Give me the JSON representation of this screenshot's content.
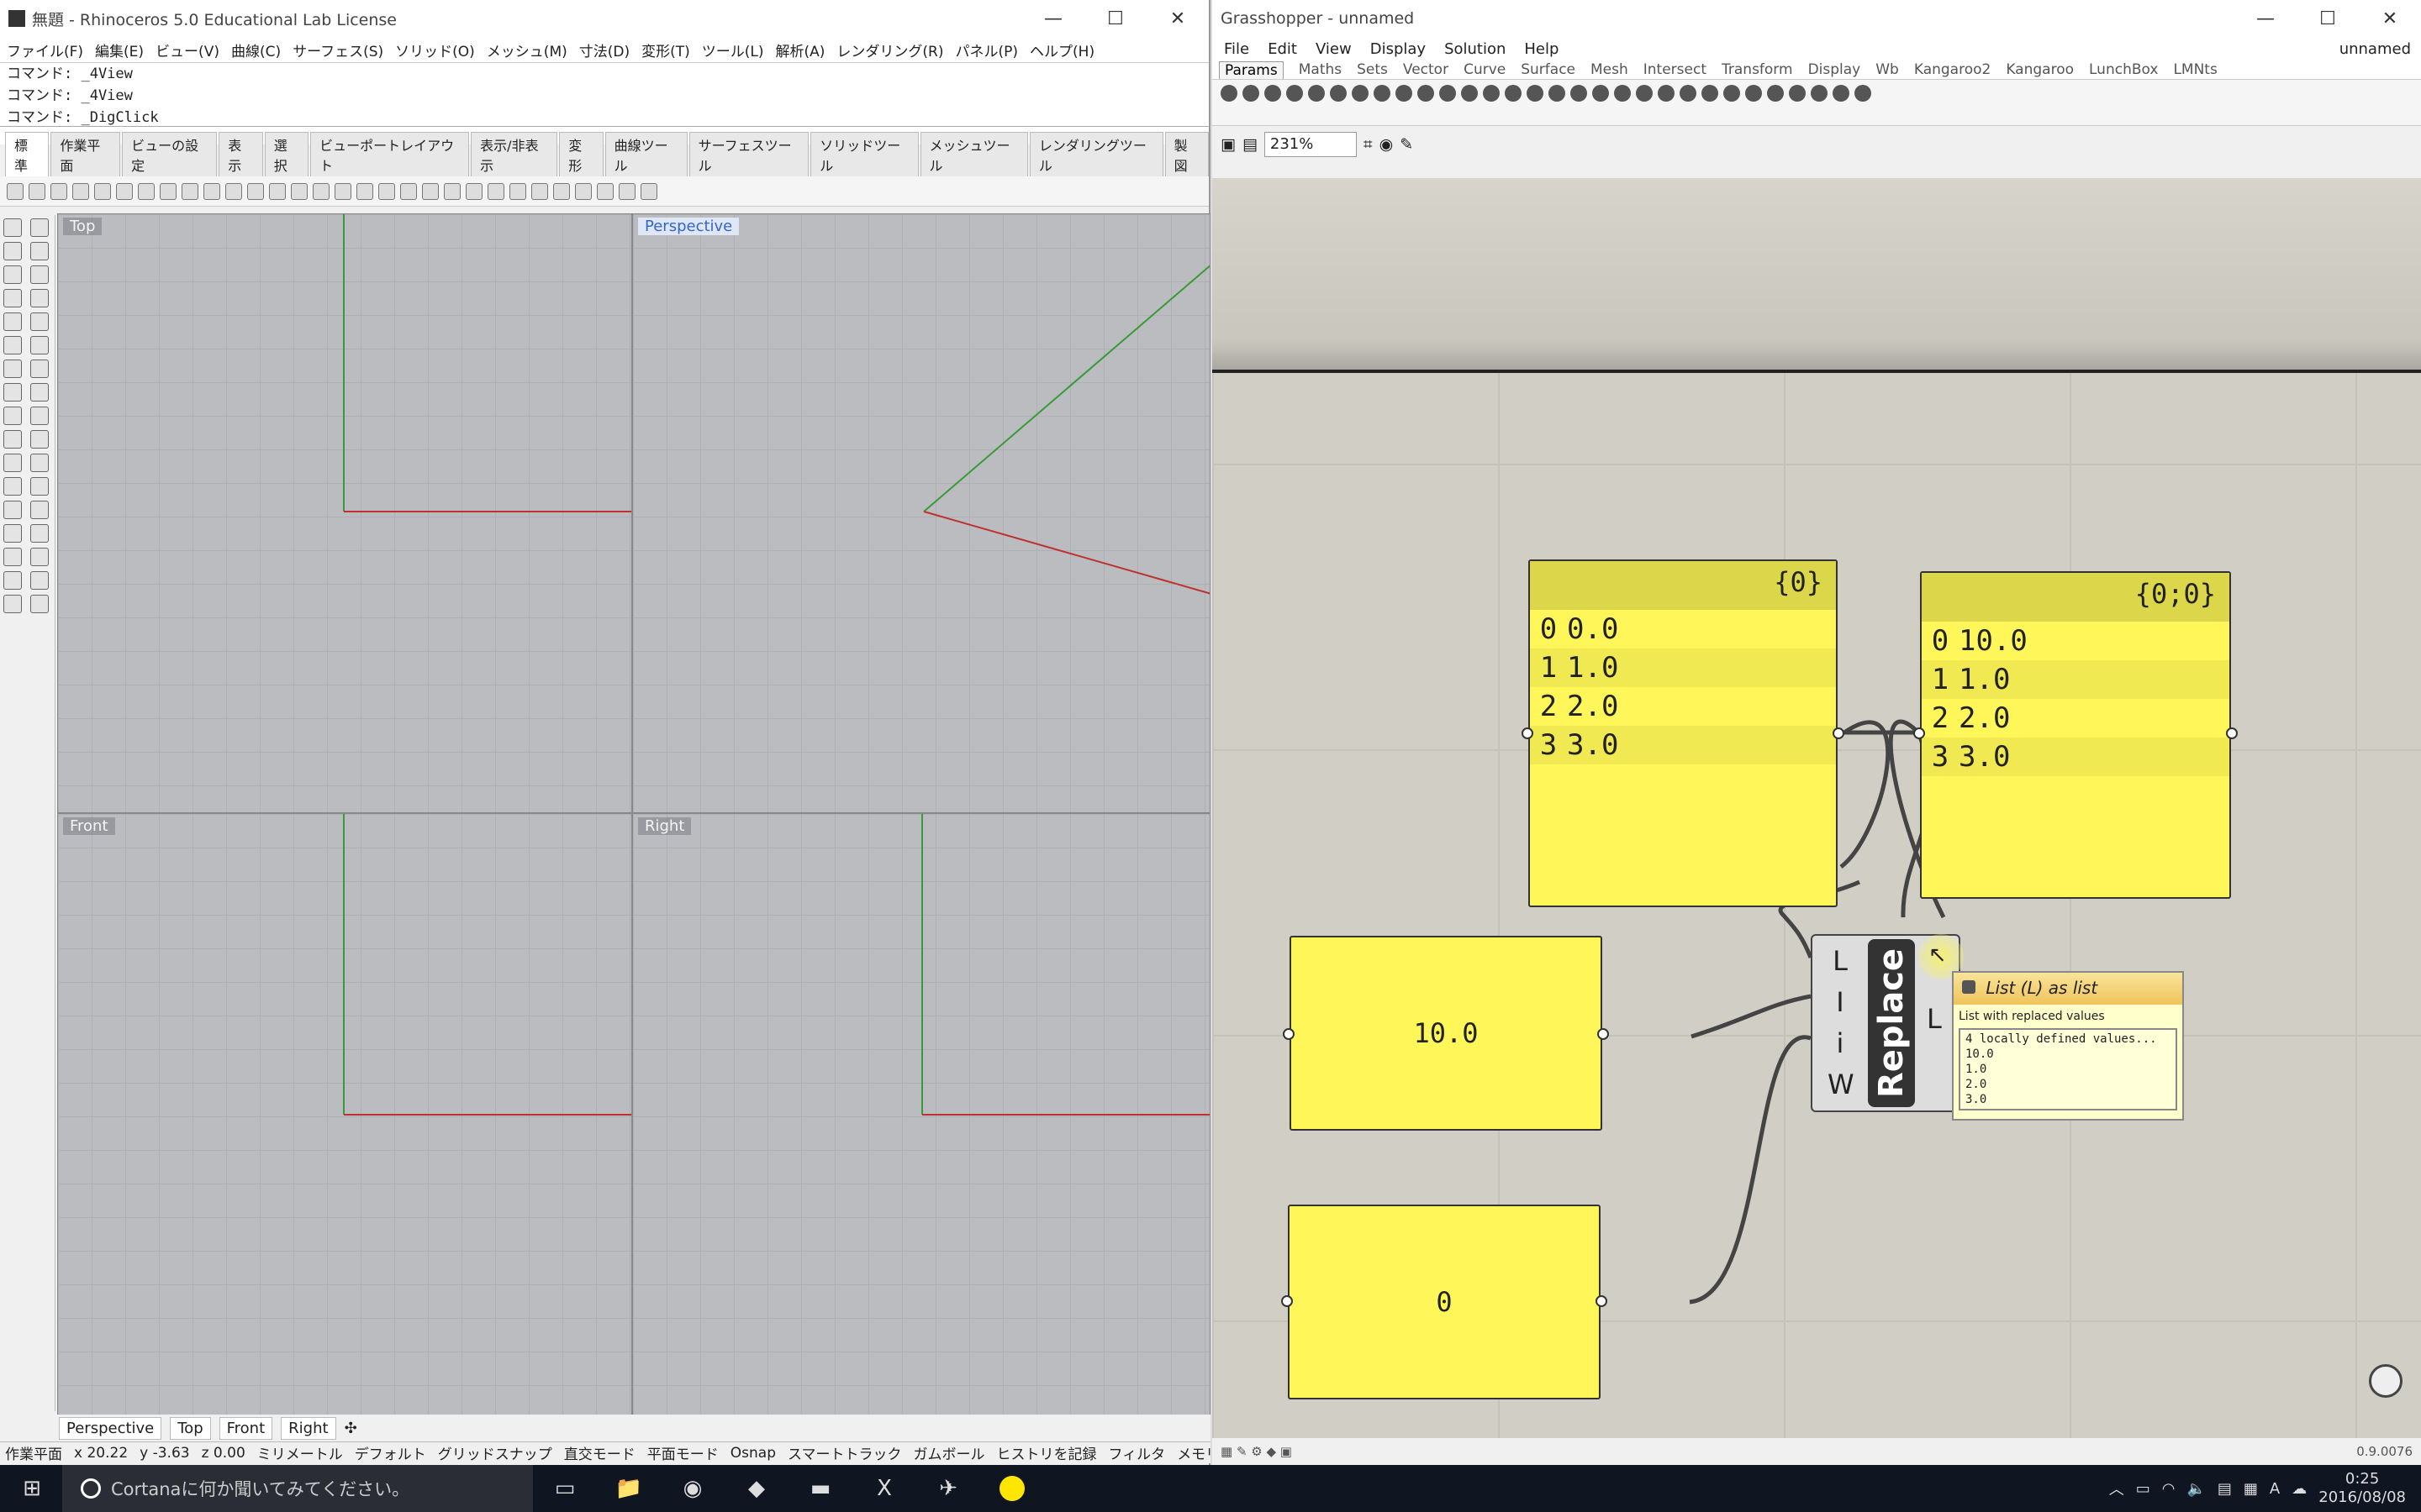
{
  "rhino": {
    "title": "無題 - Rhinoceros 5.0 Educational Lab License",
    "menu": [
      "ファイル(F)",
      "編集(E)",
      "ビュー(V)",
      "曲線(C)",
      "サーフェス(S)",
      "ソリッド(O)",
      "メッシュ(M)",
      "寸法(D)",
      "変形(T)",
      "ツール(L)",
      "解析(A)",
      "レンダリング(R)",
      "パネル(P)",
      "ヘルプ(H)"
    ],
    "cmd_history": [
      "コマンド: _4View",
      "コマンド: _4View",
      "コマンド: _DigClick"
    ],
    "cmd_prompt": "コマンド:",
    "toolbar_tabs": [
      "標準",
      "作業平面",
      "ビューの設定",
      "表示",
      "選択",
      "ビューポートレイアウト",
      "表示/非表示",
      "変形",
      "曲線ツール",
      "サーフェスツール",
      "ソリッドツール",
      "メッシュツール",
      "レンダリングツール",
      "製図"
    ],
    "viewports": {
      "top": "Top",
      "perspective": "Perspective",
      "front": "Front",
      "right": "Right"
    },
    "viewport_tabs": [
      "Perspective",
      "Top",
      "Front",
      "Right"
    ],
    "status": [
      "作業平面",
      "x 20.22",
      "y -3.63",
      "z 0.00",
      "ミリメートル",
      "デフォルト",
      "グリッドスナップ",
      "直交モード",
      "平面モード",
      "Osnap",
      "スマートトラック",
      "ガムボール",
      "ヒストリを記録",
      "フィルタ",
      "メモリ使用..."
    ]
  },
  "gh": {
    "title": "Grasshopper - unnamed",
    "doc_name": "unnamed",
    "menu": [
      "File",
      "Edit",
      "View",
      "Display",
      "Solution",
      "Help"
    ],
    "tabs": [
      "Params",
      "Maths",
      "Sets",
      "Vector",
      "Curve",
      "Surface",
      "Mesh",
      "Intersect",
      "Transform",
      "Display",
      "Wb",
      "Kangaroo2",
      "Kangaroo",
      "LunchBox",
      "LMNts"
    ],
    "zoom": "231%",
    "panel_a": {
      "path": "{0}",
      "rows": [
        [
          "0",
          "0.0"
        ],
        [
          "1",
          "1.0"
        ],
        [
          "2",
          "2.0"
        ],
        [
          "3",
          "3.0"
        ]
      ]
    },
    "panel_b": {
      "path": "{0;0}",
      "rows": [
        [
          "0",
          "10.0"
        ],
        [
          "1",
          "1.0"
        ],
        [
          "2",
          "2.0"
        ],
        [
          "3",
          "3.0"
        ]
      ]
    },
    "panel_c": "10.0",
    "panel_d": "0",
    "replace": {
      "name": "Replace",
      "inputs": [
        "L",
        "I",
        "i",
        "W"
      ],
      "output": "L"
    },
    "tooltip": {
      "title": "List (L) as list",
      "subtitle": "List with replaced values",
      "values": [
        "4 locally defined values...",
        "10.0",
        "1.0",
        "2.0",
        "3.0"
      ]
    },
    "version": "0.9.0076"
  },
  "taskbar": {
    "search": "Cortanaに何か聞いてみてください。",
    "time": "0:25",
    "date": "2016/08/08"
  }
}
